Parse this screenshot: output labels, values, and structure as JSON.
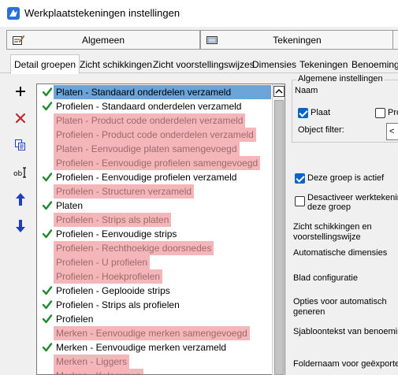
{
  "window": {
    "title": "Werkplaatstekeningen instellingen"
  },
  "main_tabs": [
    {
      "label": "Algemeen"
    },
    {
      "label": "Tekeningen"
    }
  ],
  "sub_tabs": [
    {
      "label": "Detail groepen",
      "active": true
    },
    {
      "label": "Zicht schikkingen"
    },
    {
      "label": "Zicht voorstellingswijzes"
    },
    {
      "label": "Dimensies"
    },
    {
      "label": "Tekeningen"
    },
    {
      "label": "Benoeminge"
    }
  ],
  "toolbar": {
    "add": "plus-icon",
    "delete": "delete-x-icon",
    "copy": "copy-icon",
    "rename": "rename-icon",
    "up": "arrow-up-icon",
    "down": "arrow-down-icon"
  },
  "groups": [
    {
      "label": "Platen - Standaard onderdelen verzameld",
      "checked": true,
      "state": "selected"
    },
    {
      "label": "Profielen - Standaard onderdelen verzameld",
      "checked": true,
      "state": "normal"
    },
    {
      "label": "Platen - Product code onderdelen verzameld",
      "checked": false,
      "state": "disabled"
    },
    {
      "label": "Profielen - Product code onderdelen verzameld",
      "checked": false,
      "state": "disabled"
    },
    {
      "label": "Platen - Eenvoudige platen samengevoegd",
      "checked": false,
      "state": "disabled"
    },
    {
      "label": "Profielen - Eenvoudige profielen samengevoegd",
      "checked": false,
      "state": "disabled"
    },
    {
      "label": "Profielen - Eenvoudige profielen verzameld",
      "checked": true,
      "state": "normal"
    },
    {
      "label": "Profielen - Structuren verzameld",
      "checked": false,
      "state": "disabled"
    },
    {
      "label": "Platen",
      "checked": true,
      "state": "normal"
    },
    {
      "label": "Profielen - Strips als platen",
      "checked": false,
      "state": "disabled"
    },
    {
      "label": "Profielen - Eenvoudige strips",
      "checked": true,
      "state": "normal"
    },
    {
      "label": "Profielen - Rechthoekige doorsnedes",
      "checked": false,
      "state": "disabled"
    },
    {
      "label": "Profielen - U profielen",
      "checked": false,
      "state": "disabled"
    },
    {
      "label": "Profielen - Hoekprofielen",
      "checked": false,
      "state": "disabled"
    },
    {
      "label": "Profielen - Geplooide strips",
      "checked": true,
      "state": "normal"
    },
    {
      "label": "Profielen - Strips als profielen",
      "checked": true,
      "state": "normal"
    },
    {
      "label": "Profielen",
      "checked": true,
      "state": "normal"
    },
    {
      "label": "Merken - Eenvoudige merken samengevoegd",
      "checked": false,
      "state": "disabled"
    },
    {
      "label": "Merken - Eenvoudige merken verzameld",
      "checked": true,
      "state": "normal"
    },
    {
      "label": "Merken - Liggers",
      "checked": false,
      "state": "disabled"
    },
    {
      "label": "Merken - Kolommen",
      "checked": false,
      "state": "disabled"
    }
  ],
  "right": {
    "general_title": "Algemene instellingen",
    "name_label": "Naam",
    "plate_label": "Plaat",
    "plate_checked": true,
    "profile_label": "Pro",
    "profile_checked": false,
    "object_filter_label": "Object filter:",
    "object_filter_value": "<",
    "active_label": "Deze groep is actief",
    "active_checked": true,
    "disable_label_1": "Desactiveer werktekenin",
    "disable_label_2": "deze groep",
    "disable_checked": false,
    "views_label_1": "Zicht schikkingen en",
    "views_label_2": "voorstellingswijze",
    "auto_dims_label": "Automatische dimensies",
    "sheet_config_label": "Blad configuratie",
    "auto_options_label_1": "Opties voor automatisch",
    "auto_options_label_2": "generen",
    "template_text_label": "Sjabloontekst van benoemin",
    "folder_label": "Foldernaam voor geëxporte"
  },
  "colors": {
    "selected_bg": "#6aa4d8",
    "disabled_bg": "#f4b6b8",
    "disabled_text": "#9d6a6d",
    "check_green": "#1e8a2e",
    "arrow_blue": "#1f3fbf",
    "delete_red": "#c0282d"
  }
}
